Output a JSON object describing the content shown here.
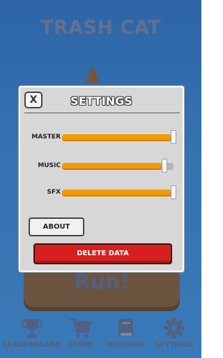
{
  "game": {
    "title": "TRASH CAT",
    "run_label": "Run!"
  },
  "nav": {
    "items": [
      {
        "label": "LEADERBOARD",
        "icon": "trophy-icon"
      },
      {
        "label": "STORE",
        "icon": "cart-icon"
      },
      {
        "label": "MISSIONS",
        "icon": "book-icon"
      },
      {
        "label": "SETTINGS",
        "icon": "gear-icon"
      }
    ]
  },
  "settings": {
    "title": "SETTINGS",
    "close_label": "X",
    "sliders": [
      {
        "label": "MASTER",
        "value": 1.0
      },
      {
        "label": "MUSIC",
        "value": 0.92
      },
      {
        "label": "SFX",
        "value": 1.0
      }
    ],
    "about_label": "ABOUT",
    "delete_label": "DELETE DATA"
  },
  "colors": {
    "accent_orange": "#f39a00",
    "danger_red": "#d62020",
    "background_blue": "#3a7fc6"
  }
}
